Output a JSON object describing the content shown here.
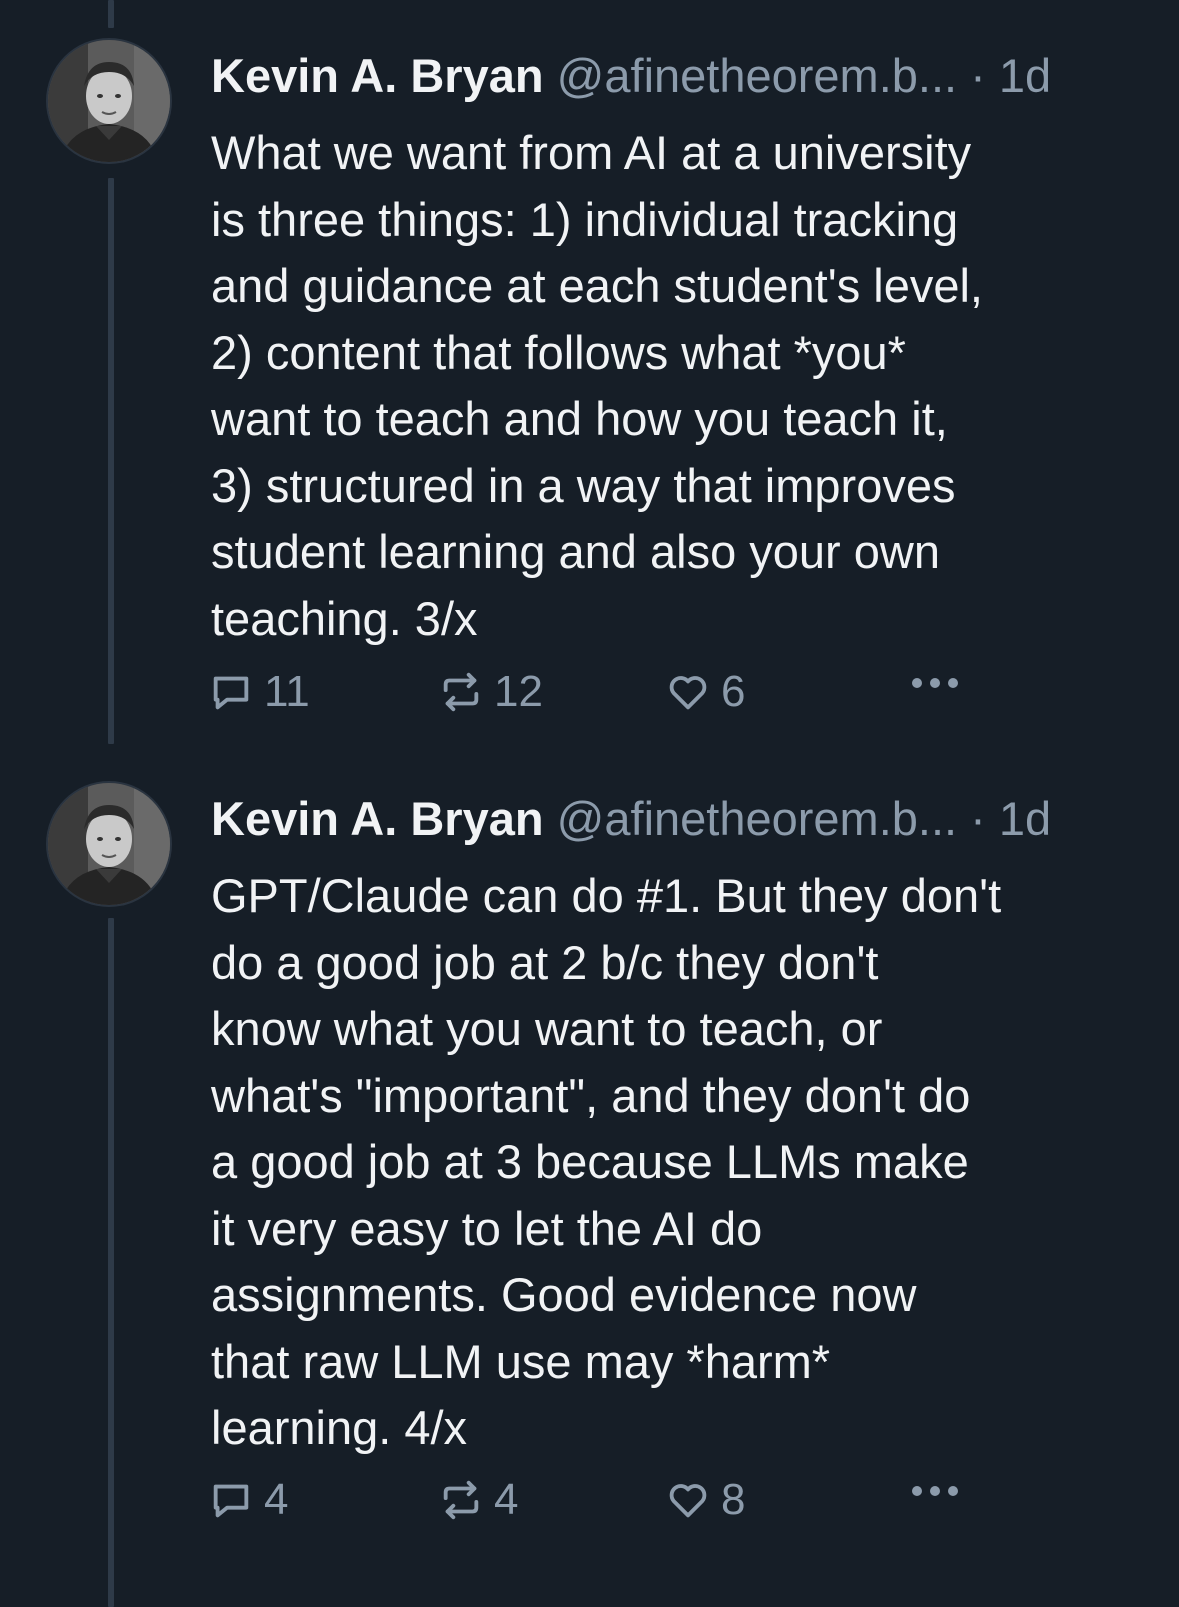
{
  "posts": [
    {
      "author_name": "Kevin A. Bryan",
      "handle": "@afinetheorem.b...",
      "separator": "·",
      "time": "1d",
      "text": "What we want from AI at a university\nis three things: 1) individual tracking\nand guidance at each student's level,\n2) content that follows what *you*\nwant to teach and how you teach it,\n3) structured in a way that improves\nstudent learning and also your own\nteaching. 3/x",
      "replies": "11",
      "reposts": "12",
      "likes": "6"
    },
    {
      "author_name": "Kevin A. Bryan",
      "handle": "@afinetheorem.b...",
      "separator": "·",
      "time": "1d",
      "text": "GPT/Claude can do #1. But they don't\ndo a good job at 2 b/c they don't\nknow what you want to teach, or\nwhat's \"important\", and they don't do\na good job at 3 because LLMs make\nit very easy to let the AI do\nassignments. Good evidence now\nthat raw LLM use may *harm*\nlearning. 4/x",
      "replies": "4",
      "reposts": "4",
      "likes": "8"
    }
  ],
  "icons": {
    "reply": "reply-icon",
    "repost": "repost-icon",
    "like": "heart-icon",
    "more": "more-options-icon"
  },
  "colors": {
    "background": "#161e27",
    "text": "#f1f3f5",
    "muted": "#8c9bab",
    "thread_line": "#2e3a48"
  }
}
